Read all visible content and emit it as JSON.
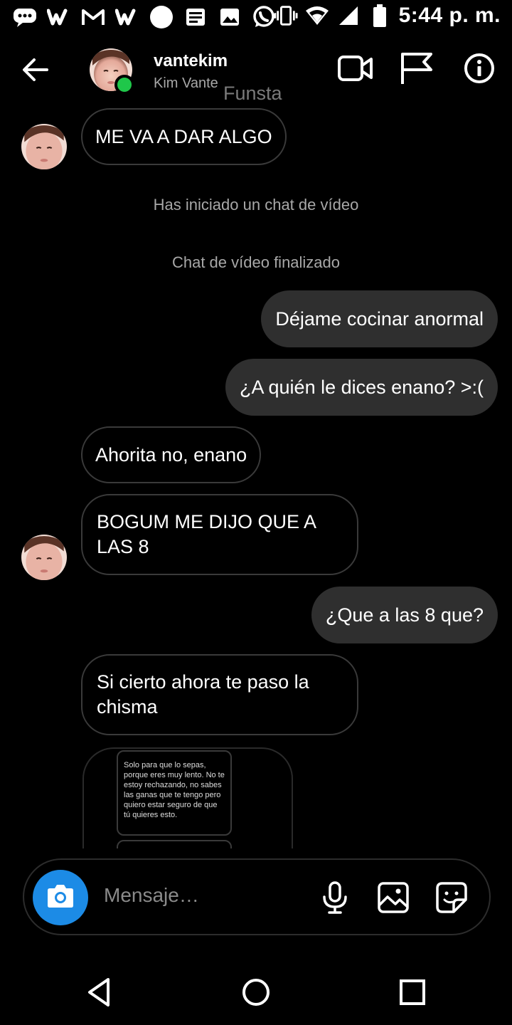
{
  "status_bar": {
    "time": "5:44 p. m.",
    "icons": [
      "message-icon",
      "wattpad-icon",
      "gmail-icon",
      "wattpad-icon",
      "circle-icon",
      "news-icon",
      "image-icon",
      "whatsapp-icon",
      "vibrate-icon",
      "wifi-icon",
      "signal-icon",
      "battery-icon"
    ]
  },
  "header": {
    "username": "vantekim",
    "full_name": "Kim Vante",
    "watermark": "Funsta",
    "icons": [
      "back-arrow-icon",
      "video-call-icon",
      "flag-icon",
      "info-icon"
    ]
  },
  "messages": [
    {
      "from": "them",
      "text": "ME VA A DAR ALGO"
    },
    {
      "type": "system",
      "text": "Has iniciado un chat de vídeo"
    },
    {
      "type": "system",
      "text": "Chat de vídeo finalizado"
    },
    {
      "from": "me",
      "text": "Déjame cocinar anormal"
    },
    {
      "from": "me",
      "text": "¿A quién le dices enano? >:("
    },
    {
      "from": "them",
      "text": "Ahorita no, enano"
    },
    {
      "from": "them",
      "text": "BOGUM ME DIJO QUE A LAS 8"
    },
    {
      "from": "me",
      "text": "¿Que a las 8 que?"
    },
    {
      "from": "them",
      "text": "Si cierto ahora te paso la chisma"
    }
  ],
  "shared_post": {
    "text": "Solo para que lo sepas, porque eres muy lento. No te estoy rechazando, no sabes las ganas que te tengo pero quiero estar seguro de que tú quieres esto."
  },
  "composer": {
    "placeholder": "Mensaje…",
    "icons": [
      "camera-icon",
      "microphone-icon",
      "gallery-icon",
      "sticker-icon"
    ]
  },
  "navbar": {
    "icons": [
      "back-triangle-icon",
      "home-circle-icon",
      "recents-square-icon"
    ]
  },
  "colors": {
    "background": "#000000",
    "outgoing_bubble": "#2f2f2f",
    "incoming_border": "#3a3a3a",
    "camera_button": "#1c8be6",
    "online": "#1fc74a",
    "secondary_text": "#a8a8a8"
  }
}
